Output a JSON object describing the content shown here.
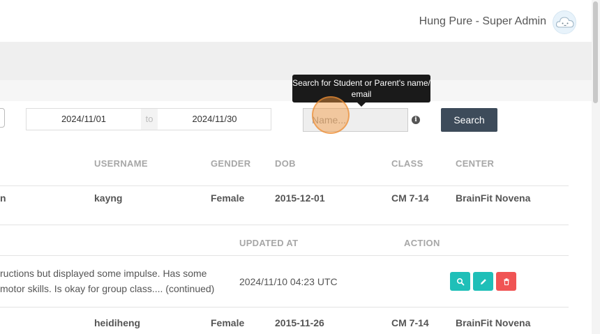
{
  "header": {
    "user": "Hung Pure - Super Admin",
    "avatar_icon": "cloud-face-icon"
  },
  "filters": {
    "date_from": "2024/11/01",
    "date_separator": "to",
    "date_to": "2024/11/30",
    "name_placeholder": "Name...",
    "tooltip": "Search for Student or Parent's name/ email",
    "search_label": "Search"
  },
  "students_table": {
    "headers": {
      "username": "USERNAME",
      "gender": "GENDER",
      "dob": "DOB",
      "class": "CLASS",
      "center": "CENTER"
    },
    "rows": [
      {
        "name_fragment": "n",
        "username": "kayng",
        "gender": "Female",
        "dob": "2015-12-01",
        "class": "CM 7-14",
        "center": "BrainFit Novena"
      },
      {
        "name_fragment": "",
        "username": "heidiheng",
        "gender": "Female",
        "dob": "2015-11-26",
        "class": "CM 7-14",
        "center": "BrainFit Novena"
      }
    ]
  },
  "notes_table": {
    "headers": {
      "updated_at": "UPDATED AT",
      "action": "ACTION"
    },
    "rows": [
      {
        "note_line1": "ructions but displayed some impulse. Has some",
        "note_line2": "motor skills. Is okay for group class.... (continued)",
        "updated_at": "2024/11/10 04:23 UTC"
      }
    ]
  },
  "colors": {
    "search_button": "#3d4b5a",
    "action_teal": "#1fbfb8",
    "action_red": "#f05454"
  }
}
